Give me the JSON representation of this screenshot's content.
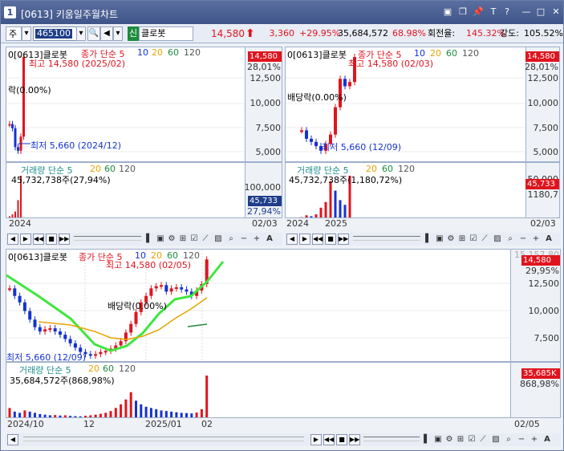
{
  "window": {
    "number": "1",
    "title": "[0613] 키움일주월차트",
    "controls": [
      "▣",
      "❐",
      "📌",
      "T",
      "?",
      "—",
      "□",
      "✕"
    ]
  },
  "toolbar": {
    "type_select": "주",
    "code": "465100",
    "market_badge": "신",
    "stock_name": "클로봇",
    "price": "14,580",
    "change": "3,360",
    "change_pct": "+29.95%",
    "volume": "35,684,572",
    "vol_ratio": "68.98%",
    "turnover_label": "회전율:",
    "turnover": "145.32%",
    "strength_label": "강도:",
    "strength": "105.52%"
  },
  "panels": {
    "daily": {
      "name_label": "0[0613]클로봇",
      "ma_label": "종가 단순 5",
      "ma_periods": [
        "10",
        "20",
        "60",
        "120"
      ],
      "high_label": "최고 14,580 (2025/02)",
      "low_label": "최저 5,660 (2024/12)",
      "pct_label": "락(0.00%)",
      "price_ticks": [
        "12,500",
        "10,000",
        "7,500",
        "5,000"
      ],
      "price_tag": "14,580",
      "price_tag2": "28,01%",
      "vol_label": "거래량 단순 5",
      "vol_periods": [
        "20",
        "60",
        "120"
      ],
      "vol_value": "45,732,738주(27,94%)",
      "vol_ticks": [
        "100,000"
      ],
      "vol_tag": "45,733",
      "vol_tag2": "27,94%",
      "date_left": "2024",
      "date_right": "02/03"
    },
    "weekly": {
      "name_label": "0[0613]클로봇",
      "ma_label": "종가 단순 5",
      "ma_periods": [
        "10",
        "20",
        "60",
        "120"
      ],
      "high_label": "최고 14,580 (02/03)",
      "low_label": "최저 5,660 (12/09)",
      "pct_label": "배당락(0.00%)",
      "price_ticks": [
        "12,500",
        "10,000",
        "7,500",
        "5,000"
      ],
      "price_tag": "14,580",
      "price_tag2": "28,01%",
      "vol_label": "거래량 단순 5",
      "vol_periods": [
        "20",
        "60",
        "120"
      ],
      "vol_value": "45,732,738주(1,180,72%)",
      "vol_ticks": [
        "50,000"
      ],
      "vol_tag": "45,733",
      "vol_tag2": "1180,7",
      "date_left": "2024",
      "date_mid": "2025",
      "date_right": "02/03"
    },
    "main": {
      "name_label": "0[0613]클로봇",
      "ma_label": "종가 단순 5",
      "ma_periods": [
        "10",
        "20",
        "60",
        "120"
      ],
      "high_label": "최고 14,580 (02/05)",
      "low_label": "최저 5,660 (12/09)",
      "pct_label": "배당락(0.00%)",
      "price_ticks": [
        "12,500",
        "10,000",
        "7,500"
      ],
      "price_tag": "14,580",
      "price_tag2": "29,95%",
      "price_top": "15,157,80",
      "vol_label": "거래량 단순 5",
      "vol_periods": [
        "20",
        "60",
        "120"
      ],
      "vol_value": "35,684,572주(868,98%)",
      "vol_tag": "35,685K",
      "vol_tag2": "868,98%",
      "dates": [
        "2024/10",
        "12",
        "2025/01",
        "02"
      ],
      "date_right": "02/05"
    }
  },
  "chart_data": [
    {
      "type": "candlestick",
      "title": "",
      "series": [
        {
          "name": "price",
          "values": [
            8200,
            7800,
            6000,
            5660,
            7000,
            14580
          ]
        },
        {
          "name": "volume",
          "values": [
            3000,
            5000,
            8000,
            20000,
            45732
          ]
        }
      ]
    },
    {
      "type": "candlestick",
      "title": "",
      "series": [
        {
          "name": "price",
          "values": [
            7600,
            6800,
            6500,
            6100,
            5660,
            6300,
            7200,
            9800,
            12500,
            11800,
            12200,
            14580
          ]
        },
        {
          "name": "volume",
          "values": [
            2000,
            4000,
            3000,
            5000,
            12000,
            18000,
            40000,
            30000,
            20000,
            15000,
            45732
          ]
        }
      ]
    },
    {
      "type": "candlestick",
      "title": "",
      "series": [
        {
          "name": "price",
          "values": [
            11900,
            11200,
            10600,
            9800,
            9000,
            8300,
            7900,
            8100,
            8200,
            7900,
            7600,
            7200,
            6800,
            6400,
            6000,
            5800,
            5660,
            5800,
            6000,
            6100,
            6300,
            6600,
            7000,
            7800,
            8600,
            9700,
            10600,
            11200,
            11900,
            12100,
            12200,
            11600,
            11900,
            12000,
            11800,
            11600,
            11200,
            11700,
            12300,
            14580
          ]
        },
        {
          "name": "volume",
          "values": [
            9000,
            6000,
            5000,
            7000,
            6000,
            5000,
            4000,
            3500,
            3000,
            3200,
            2800,
            3000,
            2500,
            2300,
            2100,
            2600,
            3000,
            3500,
            4200,
            5000,
            6500,
            9000,
            12000,
            16000,
            22000,
            15000,
            12000,
            10000,
            9000,
            8000,
            7000,
            6500,
            6000,
            5500,
            5000,
            4800,
            4500,
            5200,
            8000,
            35685
          ]
        }
      ]
    }
  ]
}
